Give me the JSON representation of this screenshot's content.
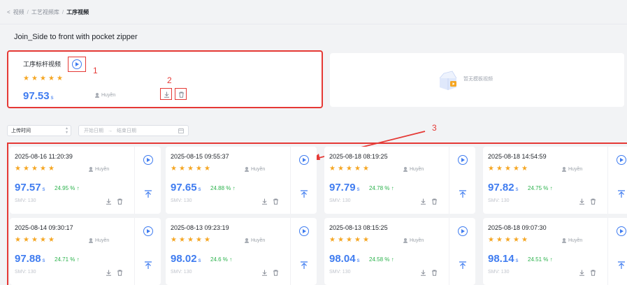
{
  "breadcrumb": {
    "back": "<",
    "items": [
      "视频",
      "工艺视频库",
      "工序视频"
    ],
    "sep": "/"
  },
  "title": "Join_Side to front with pocket zipper",
  "template": {
    "label": "工序标杆视频",
    "score": "97.53",
    "unit": "s",
    "user": "Huyền",
    "stars": 5
  },
  "empty": {
    "text": "暂无模板视频"
  },
  "annotations": {
    "n1": "1",
    "n2": "2",
    "n3": "3"
  },
  "filter": {
    "sort_label": "上传时间",
    "start_placeholder": "开始日期",
    "arrow": "→",
    "end_placeholder": "结束日期"
  },
  "videos": [
    {
      "date": "2025-08-16 11:20:39",
      "score": "97.57",
      "unit": "s",
      "pct": "24.95 % ↑",
      "smv": "SMV:  130",
      "user": "Huyền"
    },
    {
      "date": "2025-08-15 09:55:37",
      "score": "97.65",
      "unit": "s",
      "pct": "24.88 % ↑",
      "smv": "SMV:  130",
      "user": "Huyền"
    },
    {
      "date": "2025-08-18 08:19:25",
      "score": "97.79",
      "unit": "s",
      "pct": "24.78 % ↑",
      "smv": "SMV:  130",
      "user": "Huyền"
    },
    {
      "date": "2025-08-18 14:54:59",
      "score": "97.82",
      "unit": "s",
      "pct": "24.75 % ↑",
      "smv": "SMV:  130",
      "user": "Huyền"
    },
    {
      "date": "2025-08-14 09:30:17",
      "score": "97.88",
      "unit": "s",
      "pct": "24.71 % ↑",
      "smv": "SMV:  130",
      "user": "Huyền"
    },
    {
      "date": "2025-08-13 09:23:19",
      "score": "98.02",
      "unit": "s",
      "pct": "24.6 % ↑",
      "smv": "SMV:  130",
      "user": "Huyền"
    },
    {
      "date": "2025-08-13 08:15:25",
      "score": "98.04",
      "unit": "s",
      "pct": "24.58 % ↑",
      "smv": "SMV:  130",
      "user": "Huyền"
    },
    {
      "date": "2025-08-18 09:07:30",
      "score": "98.14",
      "unit": "s",
      "pct": "24.51 % ↑",
      "smv": "SMV:  130",
      "user": "Huyền"
    }
  ],
  "colors": {
    "accent": "#3f7cf0",
    "star": "#f5a623",
    "up": "#2bb24c",
    "annotation": "#e53935"
  },
  "icons": [
    "play-icon",
    "download-icon",
    "trash-icon",
    "pin-top-icon",
    "user-icon",
    "calendar-icon"
  ]
}
